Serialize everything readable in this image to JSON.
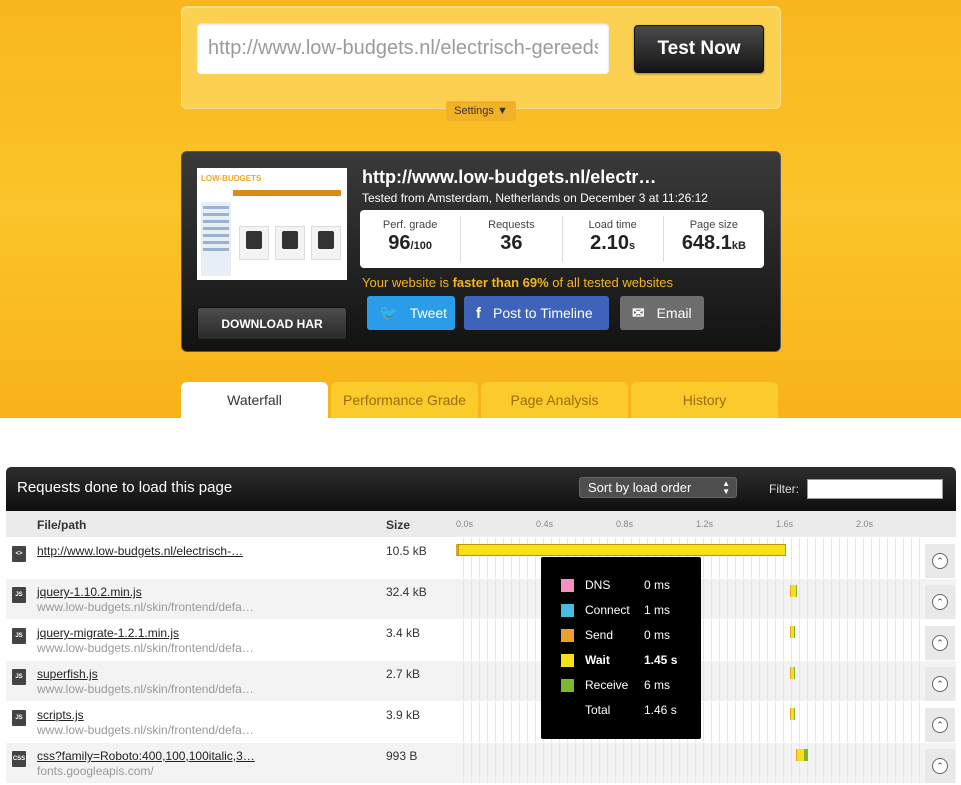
{
  "search": {
    "url_value": "http://www.low-budgets.nl/electrisch-gereedschap/",
    "test_label": "Test Now",
    "settings_label": "Settings ▼"
  },
  "result": {
    "url": "http://www.low-budgets.nl/electr…",
    "tested_from": "Tested from Amsterdam, Netherlands on December 3 at 11:26:12",
    "download_label": "DOWNLOAD HAR",
    "thumb_logo": "LOW-BUDGETS",
    "stats": [
      {
        "label": "Perf. grade",
        "value": "96",
        "unit": "/100"
      },
      {
        "label": "Requests",
        "value": "36",
        "unit": ""
      },
      {
        "label": "Load time",
        "value": "2.10",
        "unit": "s"
      },
      {
        "label": "Page size",
        "value": "648.1",
        "unit": "kB"
      }
    ],
    "faster_pre": "Your website is ",
    "faster_bold": "faster than 69%",
    "faster_post": " of all tested websites",
    "share": {
      "tweet": "Tweet",
      "facebook": "Post to Timeline",
      "email": "Email"
    }
  },
  "tabs": [
    "Waterfall",
    "Performance Grade",
    "Page Analysis",
    "History"
  ],
  "requests": {
    "title": "Requests done to load this page",
    "sort_label": "Sort by load order",
    "filter_label": "Filter:",
    "col_file": "File/path",
    "col_size": "Size",
    "ticks": [
      "0.0s",
      "0.4s",
      "0.8s",
      "1.2s",
      "1.6s",
      "2.0s"
    ],
    "rows": [
      {
        "icon": "<>",
        "name": "http://www.low-budgets.nl/electrisch-…",
        "host": "",
        "size": "10.5 kB",
        "start": 0.0,
        "wait": 1.45
      },
      {
        "icon": "JS",
        "name": "jquery-1.10.2.min.js",
        "host": "www.low-budgets.nl/skin/frontend/defa…",
        "size": "32.4 kB",
        "start": 1.67,
        "wait": 0.02
      },
      {
        "icon": "JS",
        "name": "jquery-migrate-1.2.1.min.js",
        "host": "www.low-budgets.nl/skin/frontend/defa…",
        "size": "3.4 kB",
        "start": 1.67,
        "wait": 0.01
      },
      {
        "icon": "JS",
        "name": "superfish.js",
        "host": "www.low-budgets.nl/skin/frontend/defa…",
        "size": "2.7 kB",
        "start": 1.67,
        "wait": 0.01
      },
      {
        "icon": "JS",
        "name": "scripts.js",
        "host": "www.low-budgets.nl/skin/frontend/defa…",
        "size": "3.9 kB",
        "start": 1.67,
        "wait": 0.01
      },
      {
        "icon": "CSS",
        "name": "css?family=Roboto:400,100,100italic,3…",
        "host": "fonts.googleapis.com/",
        "size": "993 B",
        "start": 1.7,
        "wait": 0.03
      }
    ]
  },
  "tooltip": [
    {
      "key": "DNS",
      "value": "0 ms",
      "color": "#f48fc0"
    },
    {
      "key": "Connect",
      "value": "1 ms",
      "color": "#44bde0"
    },
    {
      "key": "Send",
      "value": "0 ms",
      "color": "#e9a02d"
    },
    {
      "key": "Wait",
      "value": "1.45 s",
      "color": "#f7e01a",
      "bold": true
    },
    {
      "key": "Receive",
      "value": "6 ms",
      "color": "#7cb82f"
    },
    {
      "key": "Total",
      "value": "1.46 s",
      "color": ""
    }
  ]
}
